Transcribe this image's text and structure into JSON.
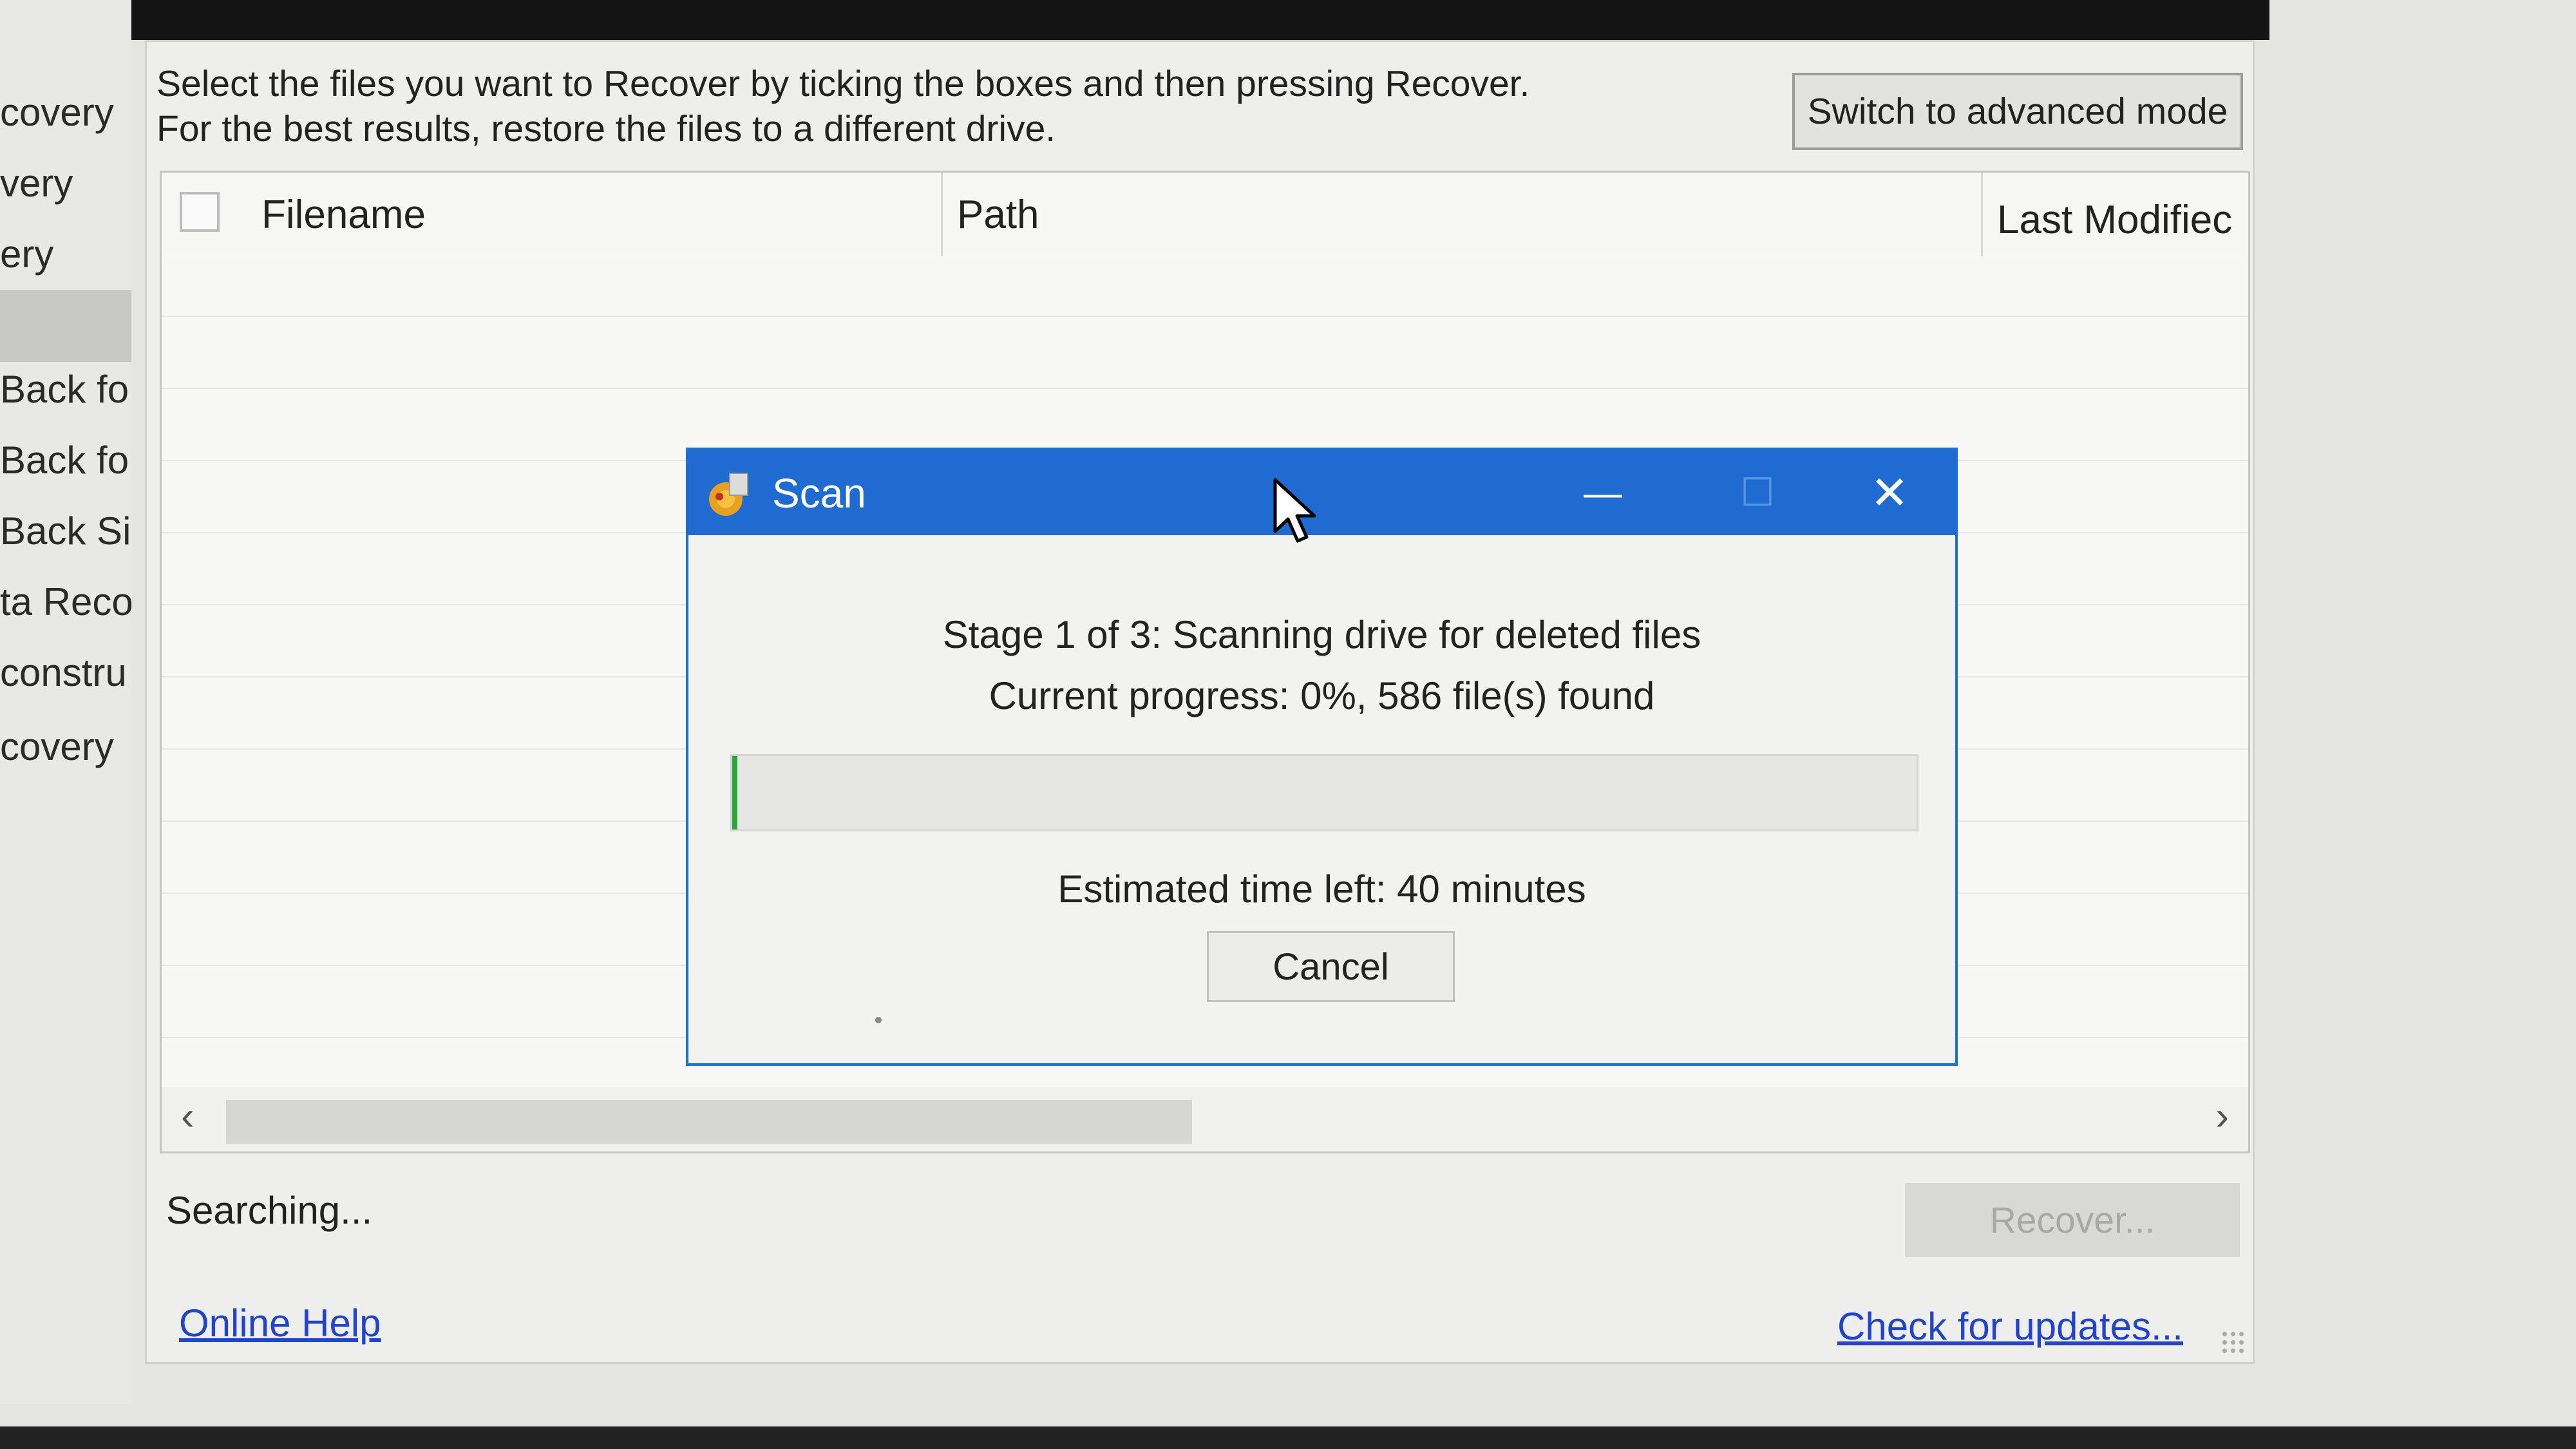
{
  "left_panel": {
    "items": [
      "covery",
      "very",
      "ery",
      "Back fo",
      "Back fo",
      "Back Si",
      "ta Reco",
      "constru",
      "covery"
    ]
  },
  "main": {
    "instruction_line1": "Select the files you want to Recover by ticking the boxes and then pressing Recover.",
    "instruction_line2": "For the best results, restore the files to a different drive.",
    "advanced_mode_label": "Switch to advanced mode",
    "columns": {
      "filename": "Filename",
      "path": "Path",
      "last_modified": "Last Modifiec"
    },
    "status": "Searching...",
    "recover_label": "Recover...",
    "online_help": "Online Help",
    "check_updates": "Check for updates..."
  },
  "scan_dialog": {
    "title": "Scan",
    "minimize_glyph": "—",
    "maximize_glyph": "☐",
    "close_glyph": "✕",
    "stage_text": "Stage 1 of 3: Scanning drive for deleted files",
    "progress_text": "Current progress: 0%, 586 file(s) found",
    "progress_percent": 0,
    "estimated_text": "Estimated time left: 40 minutes",
    "cancel_label": "Cancel"
  },
  "colors": {
    "dialog_titlebar": "#1f6bd2",
    "progress_fill": "#2aa63a",
    "link": "#2244cc"
  },
  "icons": [
    "recuva-app-icon",
    "scroll-left-icon",
    "scroll-right-icon",
    "mouse-pointer-icon",
    "resize-grip-icon"
  ]
}
